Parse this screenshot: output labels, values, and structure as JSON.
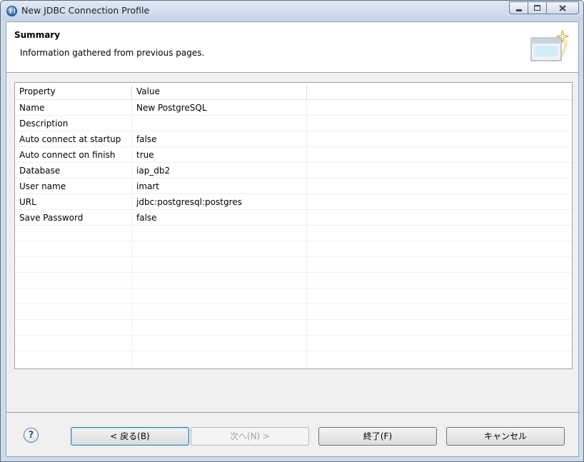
{
  "window": {
    "title": "New JDBC Connection Profile"
  },
  "header": {
    "title": "Summary",
    "description": "Information gathered from previous pages."
  },
  "table": {
    "columns": [
      "Property",
      "Value",
      ""
    ],
    "rows": [
      {
        "property": "Name",
        "value": "New PostgreSQL"
      },
      {
        "property": "Description",
        "value": ""
      },
      {
        "property": "Auto connect at startup",
        "value": "false"
      },
      {
        "property": "Auto connect on finish",
        "value": "true"
      },
      {
        "property": "Database",
        "value": "iap_db2"
      },
      {
        "property": "User name",
        "value": "imart"
      },
      {
        "property": "URL",
        "value": "jdbc:postgresql:postgres"
      },
      {
        "property": "Save Password",
        "value": "false"
      }
    ]
  },
  "buttons": {
    "help": "?",
    "back": "< 戻る(B)",
    "next": "次へ(N) >",
    "finish": "終了(F)",
    "cancel": "キャンセル"
  },
  "icons": {
    "app": "eclipse-icon",
    "banner": "wizard-banner-icon",
    "minimize": "minimize-icon",
    "maximize": "maximize-icon",
    "close": "close-icon"
  },
  "colors": {
    "titlebar": "#cfdbe8",
    "dialog_bg": "#f0f0f0",
    "default_button_border": "#3c7fb1"
  }
}
